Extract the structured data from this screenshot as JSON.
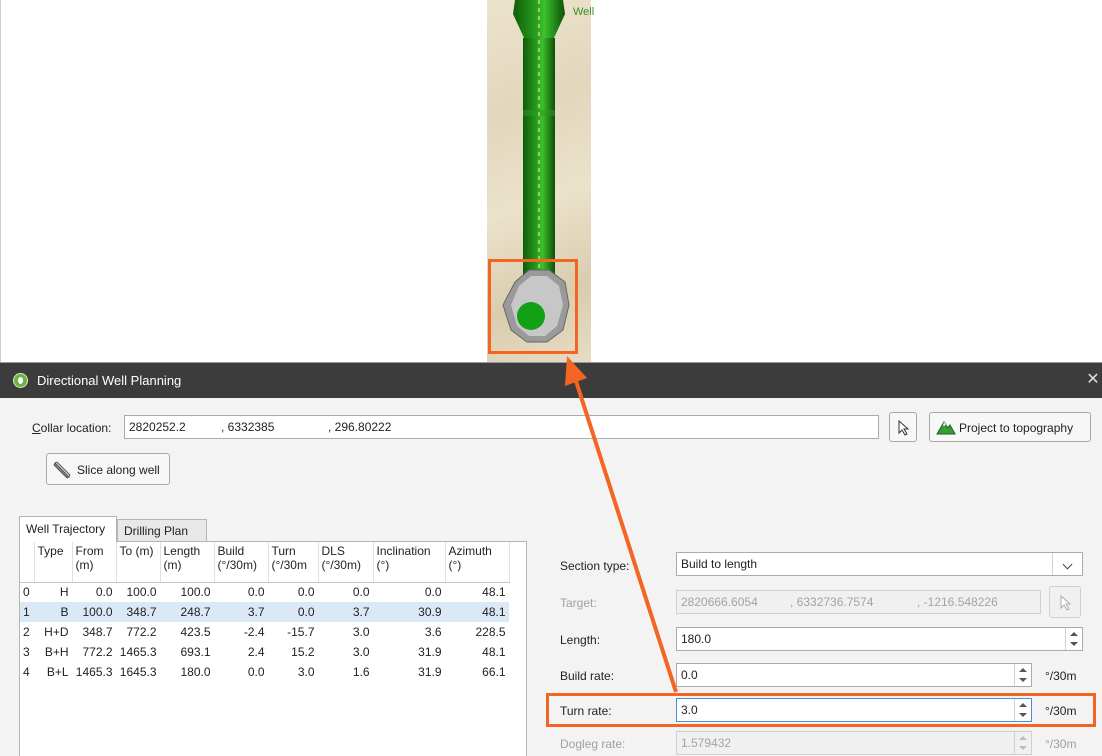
{
  "viewport": {
    "well_label": "Well"
  },
  "dialog": {
    "title": "Directional Well Planning",
    "close_glyph": "✕",
    "collar": {
      "label": "Collar location:",
      "x": "2820252.2",
      "y": ", 6332385",
      "z": ", 296.80222"
    },
    "project_button": "Project to topography",
    "slice_button": "Slice along well",
    "tabs": [
      "Well Trajectory",
      "Drilling Plan"
    ],
    "table": {
      "headers": [
        "",
        "Type",
        "From (m)",
        "To (m)",
        "Length (m)",
        "Build (°/30m)",
        "Turn (°/30m",
        "DLS (°/30m)",
        "Inclination (°)",
        "Azimuth (°)"
      ],
      "rows": [
        [
          "0",
          "H",
          "0.0",
          "100.0",
          "100.0",
          "0.0",
          "0.0",
          "0.0",
          "0.0",
          "48.1"
        ],
        [
          "1",
          "B",
          "100.0",
          "348.7",
          "248.7",
          "3.7",
          "0.0",
          "3.7",
          "30.9",
          "48.1"
        ],
        [
          "2",
          "H+D",
          "348.7",
          "772.2",
          "423.5",
          "-2.4",
          "-15.7",
          "3.0",
          "3.6",
          "228.5"
        ],
        [
          "3",
          "B+H",
          "772.2",
          "1465.3",
          "693.1",
          "2.4",
          "15.2",
          "3.0",
          "31.9",
          "48.1"
        ],
        [
          "4",
          "B+L",
          "1465.3",
          "1645.3",
          "180.0",
          "0.0",
          "3.0",
          "1.6",
          "31.9",
          "66.1"
        ]
      ],
      "selected_row": 1
    },
    "form": {
      "section_type": {
        "label": "Section type:",
        "value": "Build to length"
      },
      "target": {
        "label": "Target:",
        "x": "2820666.6054",
        "y": ", 6332736.7574",
        "z": ", -1216.548226"
      },
      "length": {
        "label": "Length:",
        "value": "180.0"
      },
      "build_rate": {
        "label": "Build rate:",
        "value": "0.0",
        "unit": "°/30m"
      },
      "turn_rate": {
        "label": "Turn rate:",
        "value": "3.0",
        "unit": "°/30m"
      },
      "dogleg_rate": {
        "label": "Dogleg rate:",
        "value": "1.579432",
        "unit": "°/30m"
      }
    }
  },
  "colors": {
    "highlight": "#f26522",
    "well_green": "#1e8c14",
    "titlebar": "#3c3c3c"
  }
}
